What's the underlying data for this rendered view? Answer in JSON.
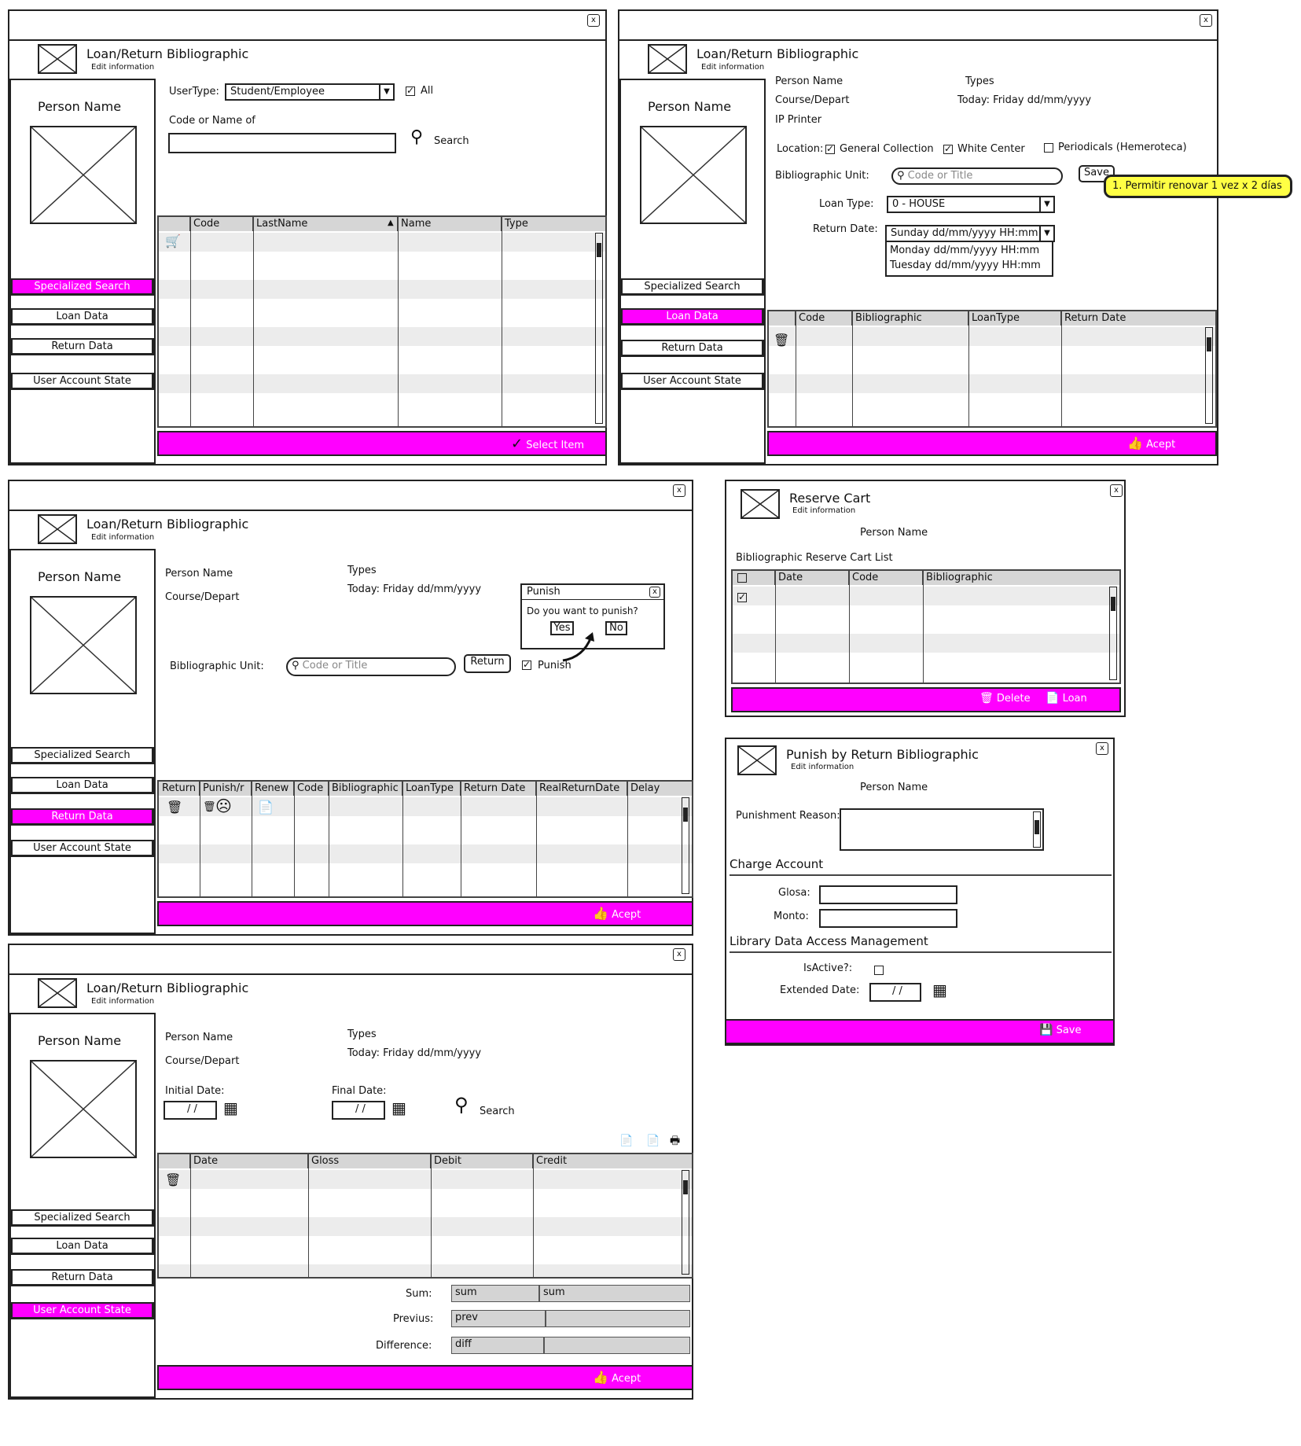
{
  "common": {
    "title": "Loan/Return Bibliographic",
    "subtitle": "Edit information",
    "person_name": "Person Name",
    "nav": [
      "Specialized Search",
      "Loan Data",
      "Return Data",
      "User Account State"
    ],
    "close": "x",
    "accent_color": "#ff00ff"
  },
  "w1": {
    "usertype_label": "UserType:",
    "usertype_value": "Student/Employee",
    "all_label": "All",
    "code_label": "Code or Name of",
    "search_label": "Search",
    "columns": [
      "Code",
      "LastName",
      "Name",
      "Type"
    ],
    "select_item": "Select Item"
  },
  "w2": {
    "person_name": "Person Name",
    "course": "Course/Depart",
    "ip_printer": "IP Printer",
    "types": "Types",
    "today": "Today: Friday dd/mm/yyyy",
    "location_label": "Location:",
    "loc_general": "General Collection",
    "loc_white": "White Center",
    "loc_periodicals": "Periodicals (Hemeroteca)",
    "bib_unit_label": "Bibliographic Unit:",
    "bib_placeholder": "Code or Title",
    "save": "Save",
    "note": "1. Permitir renovar 1 vez x 2 días",
    "loan_type_label": "Loan Type:",
    "loan_type_value": "0 - HOUSE",
    "return_date_label": "Return Date:",
    "return_date_value": "Sunday dd/mm/yyyy HH:mm",
    "return_options": [
      "Monday dd/mm/yyyy HH:mm",
      "Tuesday dd/mm/yyyy HH:mm"
    ],
    "columns": [
      "Code",
      "Bibliographic",
      "LoanType",
      "Return Date"
    ],
    "accept": "Acept"
  },
  "w3": {
    "person_name": "Person Name",
    "course": "Course/Depart",
    "types": "Types",
    "today": "Today: Friday dd/mm/yyyy",
    "bib_unit_label": "Bibliographic Unit:",
    "bib_placeholder": "Code or Title",
    "return_btn": "Return",
    "punish_label": "Punish",
    "dialog_title": "Punish",
    "dialog_q": "Do you want to punish?",
    "yes": "Yes",
    "no": "No",
    "columns": [
      "Return",
      "Punish/r",
      "Renew",
      "Code",
      "Bibliographic",
      "LoanType",
      "Return Date",
      "RealReturnDate",
      "Delay"
    ],
    "accept": "Acept"
  },
  "w4": {
    "person_name": "Person Name",
    "course": "Course/Depart",
    "types": "Types",
    "today": "Today: Friday dd/mm/yyyy",
    "initial_date_label": "Initial Date:",
    "final_date_label": "Final Date:",
    "date_value": "/ /",
    "search_label": "Search",
    "columns": [
      "Date",
      "Gloss",
      "Debit",
      "Credit"
    ],
    "sum_label": "Sum:",
    "sum_vals": [
      "sum",
      "sum"
    ],
    "previous_label": "Previus:",
    "previous_val": "prev",
    "difference_label": "Difference:",
    "difference_val": "diff",
    "accept": "Acept"
  },
  "w5": {
    "title": "Reserve Cart",
    "subtitle": "Edit information",
    "person_name": "Person Name",
    "list_label": "Bibliographic Reserve Cart List",
    "columns": [
      "Date",
      "Code",
      "Bibliographic"
    ],
    "delete": "Delete",
    "loan": "Loan"
  },
  "w6": {
    "title": "Punish by Return Bibliographic",
    "subtitle": "Edit information",
    "person_name": "Person Name",
    "reason_label": "Punishment Reason:",
    "charge_account": "Charge Account",
    "glosa_label": "Glosa:",
    "monto_label": "Monto:",
    "library_access": "Library Data Access Management",
    "isactive_label": "IsActive?:",
    "extended_label": "Extended Date:",
    "date_value": "/ /",
    "save": "Save"
  }
}
